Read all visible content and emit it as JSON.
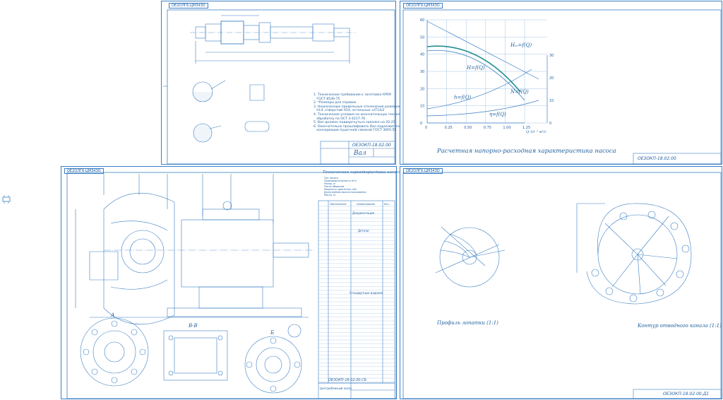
{
  "sheets": {
    "shaft": {
      "stamp": "ОЕ2ОЛГ6-ЦМЗ4ЗО",
      "title_code": "ОЕ3ОКП-18.02.00",
      "title_name": "Вал",
      "notes": "1. Технические требования к заготовке КР09\n   ГОСТ 8536-75\n2. *Размеры для справок.\n3. Неуказанные предельные отклонения размеров: валов\n   h14, отверстий H14, остальных ±IT14/2\n4. Технические условия на окончательную технологическую\n   обработку по ОСТ 3-4217-76\n5. Вал должен подвергнуться закалке на 20-25\n6. Окончательно прошлифовать Вал подлежит термообработке и\n   консервации пушечной смазкой ГОСТ 3005-55"
    },
    "chart": {
      "stamp": "ОЕ2ОЛГ6-ЦМЗ4ЗО",
      "title_code": "ОЕ3ОКП-18.02.00",
      "caption": "Расчетная напорно-расходная характеристика насоса"
    },
    "assembly": {
      "stamp": "ОЕ2ОЛГ6-ЦМЗ4ЗО",
      "spec_title": "Техническая характеристика насоса",
      "tech_specs": [
        "Тип насоса",
        "Производительность м³/ч",
        "Напор, м",
        "Число оборотов",
        "Мощность двигателя, кВт",
        "Допускаемая высота всасывания",
        "Масса, кг"
      ],
      "sections": [
        "Документация",
        "Детали",
        "Стандартные изделия"
      ],
      "spec_header": [
        "Обозначение",
        "Наименование",
        "Кол."
      ],
      "title_code": "ОЕ3ОКП-18.02.00.СБ",
      "title_name": "Центробежный насос",
      "view_labels": [
        "А",
        "В-В",
        "Б"
      ]
    },
    "profile": {
      "stamp": "ОЕ2ОЛГ6-ЦМЗ4ЗО",
      "caption_left": "Профиль лопатки (1:1)",
      "caption_right": "Контур отводного канала (1:1)",
      "title_code": "ОЕ3ОКП-18.02.00.Д1"
    }
  },
  "chart_data": {
    "type": "line",
    "title": "Расчетная напорно-расходная характеристика насоса",
    "x_ticks": [
      "0",
      "0.25",
      "0.50",
      "0.75",
      "1.00",
      "1.25"
    ],
    "y_left_ticks": [
      "0",
      "10",
      "20",
      "30",
      "40",
      "50",
      "60"
    ],
    "y_right_ticks": [
      "0",
      "10",
      "20",
      "30"
    ],
    "xlabel": "Q·10⁻³ м³/с",
    "series_labels": [
      "Hₘ=f(Q)",
      "H=f(Q)",
      "N=f(Q)",
      "h=f(Q)",
      "η=f(Q)"
    ]
  }
}
